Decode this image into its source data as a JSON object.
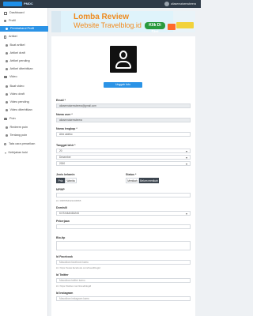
{
  "header": {
    "logo_text": "PMDC",
    "user_name": "aliasemaisenwbeera"
  },
  "sidebar": {
    "items": [
      {
        "label": "Dashboard",
        "icon": "grid-icon"
      },
      {
        "label": "Profil",
        "icon": "user-icon"
      },
      {
        "label": "Pembaharui Profil",
        "icon": "user-icon"
      },
      {
        "label": "Artikel",
        "icon": "doc-icon"
      },
      {
        "label": "Buat artikel",
        "icon": "dot-icon"
      },
      {
        "label": "Artikel draft",
        "icon": "dot-icon"
      },
      {
        "label": "Artikel pending",
        "icon": "dot-icon"
      },
      {
        "label": "Artikel diterbitkan",
        "icon": "dot-icon"
      },
      {
        "label": "Video",
        "icon": "video-icon"
      },
      {
        "label": "Buat video",
        "icon": "dot-icon"
      },
      {
        "label": "Video draft",
        "icon": "dot-icon"
      },
      {
        "label": "Video pending",
        "icon": "dot-icon"
      },
      {
        "label": "Video diterbitkan",
        "icon": "dot-icon"
      },
      {
        "label": "Poin",
        "icon": "people-icon"
      },
      {
        "label": "Redeem poin",
        "icon": "dot-icon"
      },
      {
        "label": "Tentang poin",
        "icon": "dot-icon"
      },
      {
        "label": "Tata cara penarikan",
        "icon": "key-icon"
      },
      {
        "label": "Kebijakan kuki",
        "icon": "caret-icon"
      }
    ]
  },
  "banner": {
    "title": "Lomba Review",
    "subtitle": "Website Travelblog.id",
    "cta": "Klik Di Sini"
  },
  "form": {
    "upload_label": "Unggah foto",
    "email_label": "Email *",
    "email_value": "aliasemaisenwbeera@gmail.com",
    "username_label": "Nama user *",
    "username_value": "aliasemaisenwbeera",
    "fullname_label": "Nama lengkap *",
    "fullname_value": "Alex aideko",
    "dob_label": "Tanggal lahir *",
    "dob_day": "20",
    "dob_month": "Desember",
    "dob_year": "2000",
    "gender_label": "Jenis kelamin",
    "gender_options": [
      "Pria",
      "Wanita"
    ],
    "status_label": "Status *",
    "status_options": [
      "Menikah",
      "Belum menikah"
    ],
    "nik_label": "NPWP",
    "nik_help": "ini: 0987654321234565",
    "city_label": "Domisili",
    "city_value": "KOTA BANDUNG",
    "job_label": "Pekerjaan",
    "bio_label": "Bio-tip",
    "facebook_label": "Id Facebook",
    "facebook_placeholder": "Masukkan facebook kamu",
    "facebook_help": "ini: https://www.facebook.com/travelblogid",
    "twitter_label": "Id Twitter",
    "twitter_placeholder": "Masukkan twitter kamu",
    "twitter_help": "ini: https://twitter.com/travelblogid",
    "instagram_label": "Id Instagram",
    "instagram_placeholder": "Masukkan instagram kamu"
  }
}
